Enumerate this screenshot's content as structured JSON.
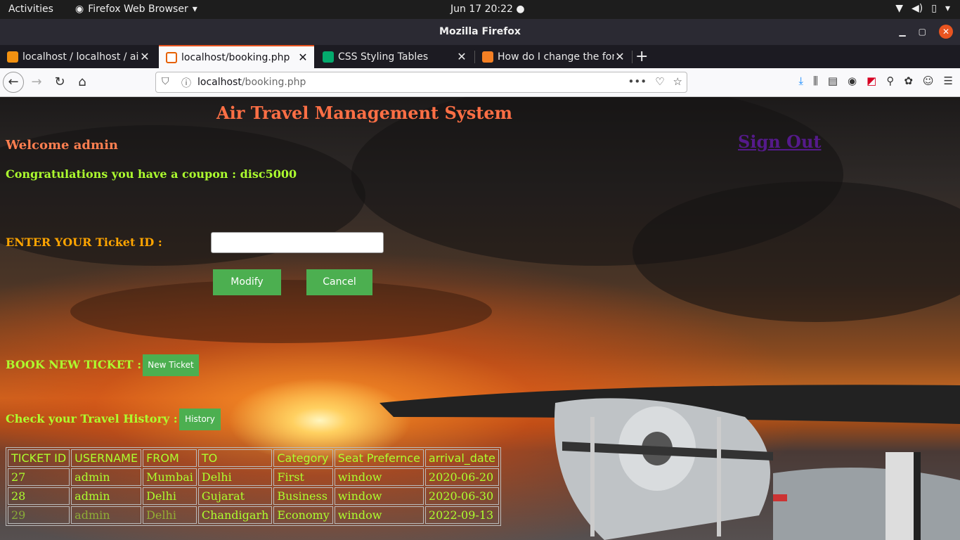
{
  "system": {
    "activities": "Activities",
    "app_menu": "Firefox Web Browser",
    "clock": "Jun 17  20:22"
  },
  "window": {
    "title": "Mozilla Firefox"
  },
  "tabs": [
    {
      "label": "localhost / localhost / air",
      "active": false
    },
    {
      "label": "localhost/booking.php",
      "active": true
    },
    {
      "label": "CSS Styling Tables",
      "active": false
    },
    {
      "label": "How do I change the font",
      "active": false
    }
  ],
  "navbar": {
    "url_host": "localhost",
    "url_path": "/booking.php"
  },
  "page": {
    "heading": "Air Travel Management System",
    "welcome": "Welcome admin",
    "signout": "Sign Out",
    "coupon": "Congratulations you have a coupon : disc5000",
    "ticket_label": "ENTER YOUR Ticket ID :",
    "ticket_input_value": "",
    "modify_button": "Modify",
    "cancel_button": "Cancel",
    "book_label": "BOOK NEW TICKET :",
    "new_ticket_button": "New Ticket",
    "history_label": "Check your Travel History :",
    "history_button": "History"
  },
  "table": {
    "headers": [
      "TICKET ID",
      "USERNAME",
      "FROM",
      "TO",
      "Category",
      "Seat Prefernce",
      "arrival_date"
    ],
    "rows": [
      [
        "27",
        "admin",
        "Mumbai",
        "Delhi",
        "First",
        "window",
        "2020-06-20"
      ],
      [
        "28",
        "admin",
        "Delhi",
        "Gujarat",
        "Business",
        "window",
        "2020-06-30"
      ],
      [
        "29",
        "admin",
        "Delhi",
        "Chandigarh",
        "Economy",
        "window",
        "2022-09-13"
      ]
    ]
  },
  "colors": {
    "heading": "#ff6f45",
    "lime": "#adff2f",
    "orange": "#ffa500",
    "button_green": "#4caf50",
    "link_visited": "#551a8b",
    "ubuntu_orange": "#e95420"
  }
}
